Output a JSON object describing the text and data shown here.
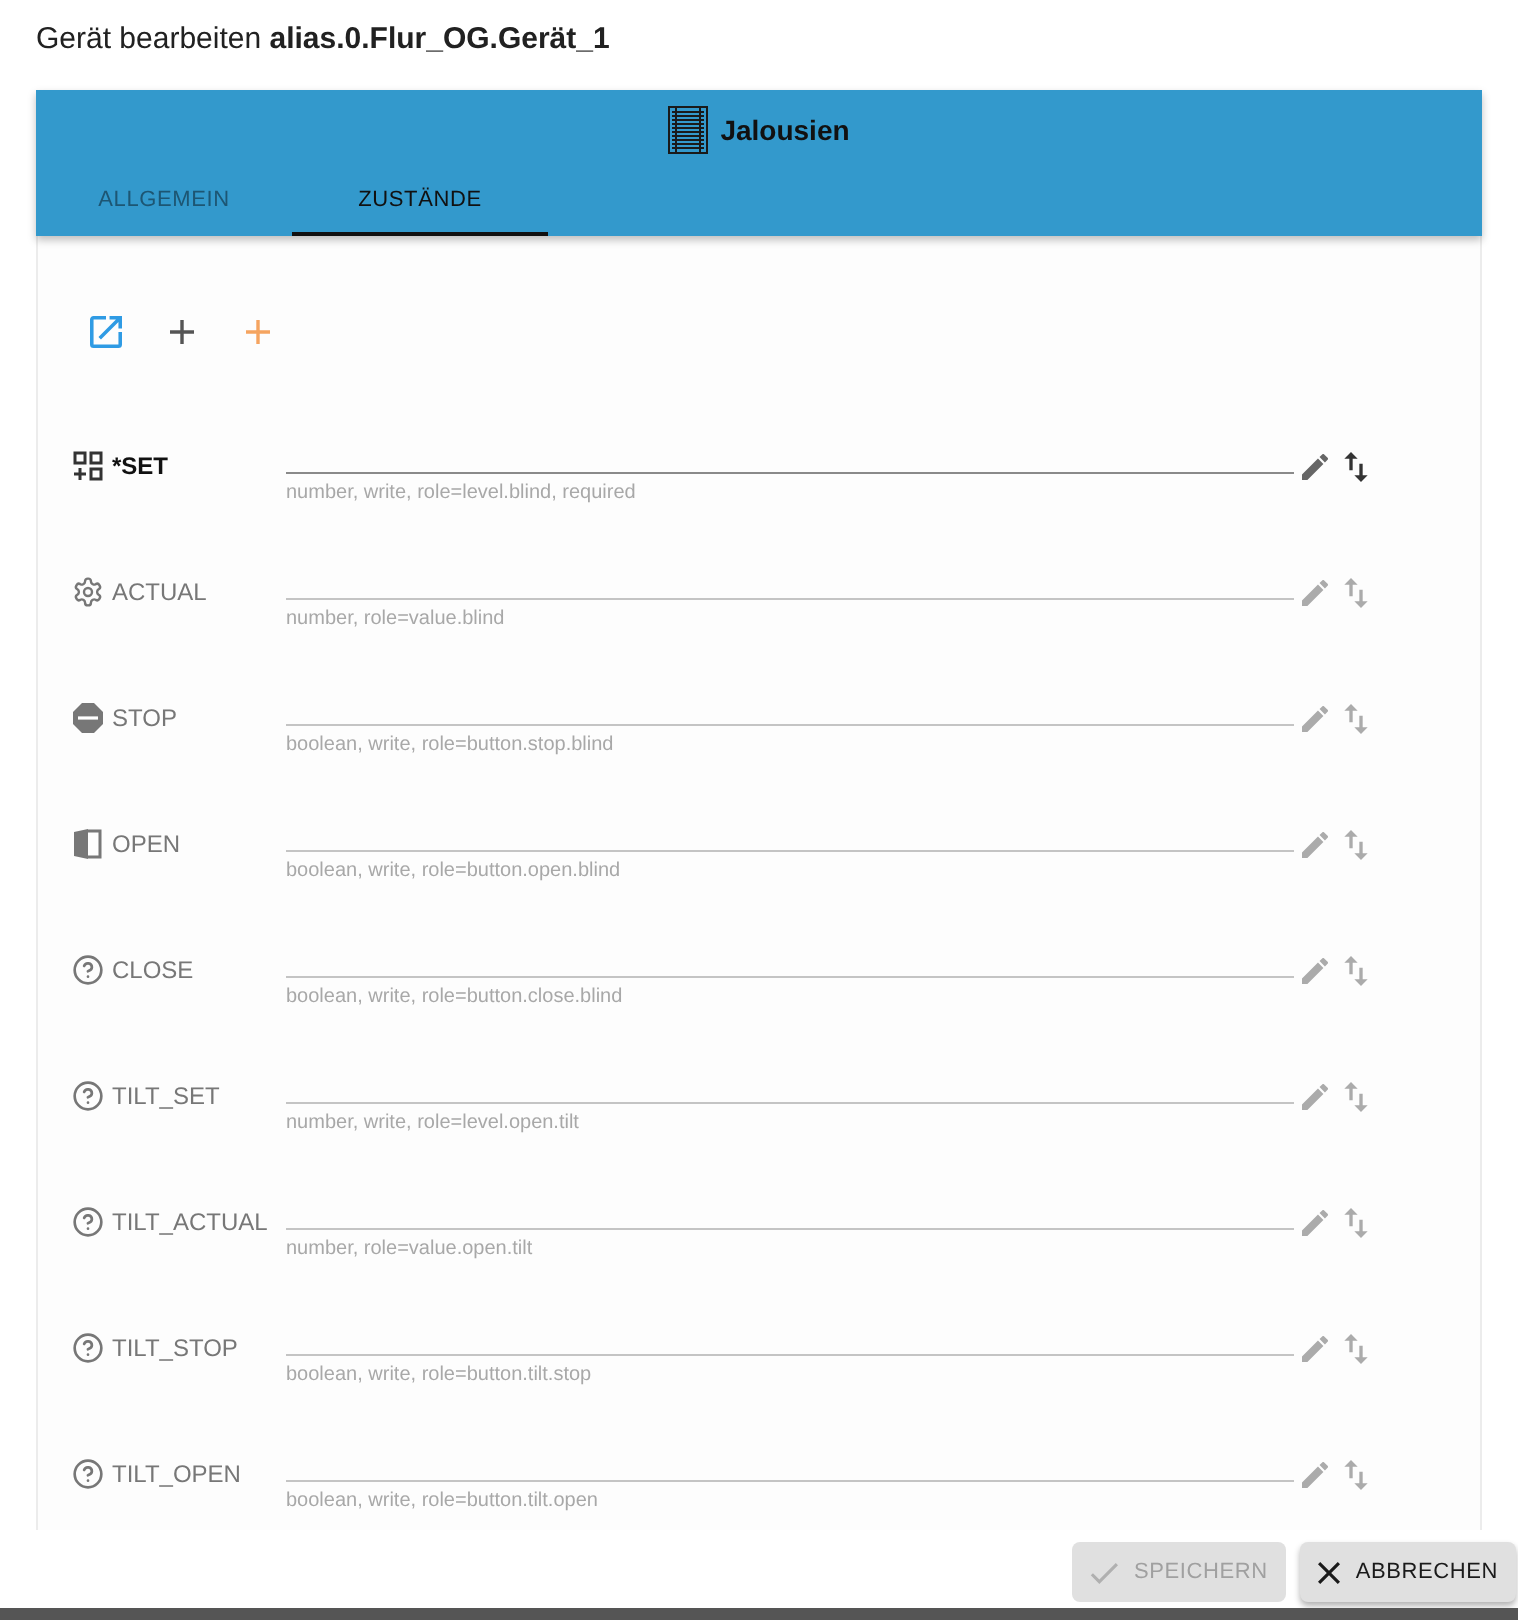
{
  "title": "Gerät bearbeiten **alias.0.Flur_OG.Gerät_1**",
  "header": {
    "title": "Jalousien"
  },
  "tabs": [
    {
      "label": "ALLGEMEIN",
      "selected": false
    },
    {
      "label": "ZUSTÄNDE",
      "selected": true
    }
  ],
  "states": [
    {
      "kind": "set",
      "name": "*SET",
      "required": true,
      "hint": "number, write, role=level.blind, required"
    },
    {
      "kind": "gear",
      "name": "ACTUAL",
      "required": false,
      "hint": "number, role=value.blind"
    },
    {
      "kind": "stop",
      "name": "STOP",
      "required": false,
      "hint": "boolean, write, role=button.stop.blind"
    },
    {
      "kind": "door",
      "name": "OPEN",
      "required": false,
      "hint": "boolean, write, role=button.open.blind"
    },
    {
      "kind": "help",
      "name": "CLOSE",
      "required": false,
      "hint": "boolean, write, role=button.close.blind"
    },
    {
      "kind": "help",
      "name": "TILT_SET",
      "required": false,
      "hint": "number, write, role=level.open.tilt"
    },
    {
      "kind": "help",
      "name": "TILT_ACTUAL",
      "required": false,
      "hint": "number, role=value.open.tilt"
    },
    {
      "kind": "help",
      "name": "TILT_STOP",
      "required": false,
      "hint": "boolean, write, role=button.tilt.stop"
    },
    {
      "kind": "help",
      "name": "TILT_OPEN",
      "required": false,
      "hint": "boolean, write, role=button.tilt.open"
    }
  ],
  "buttons": [
    {
      "kind": "save",
      "label": "SPEICHERN",
      "disabled": true
    },
    {
      "kind": "cancel",
      "label": "ABBRECHEN",
      "disabled": false
    }
  ]
}
